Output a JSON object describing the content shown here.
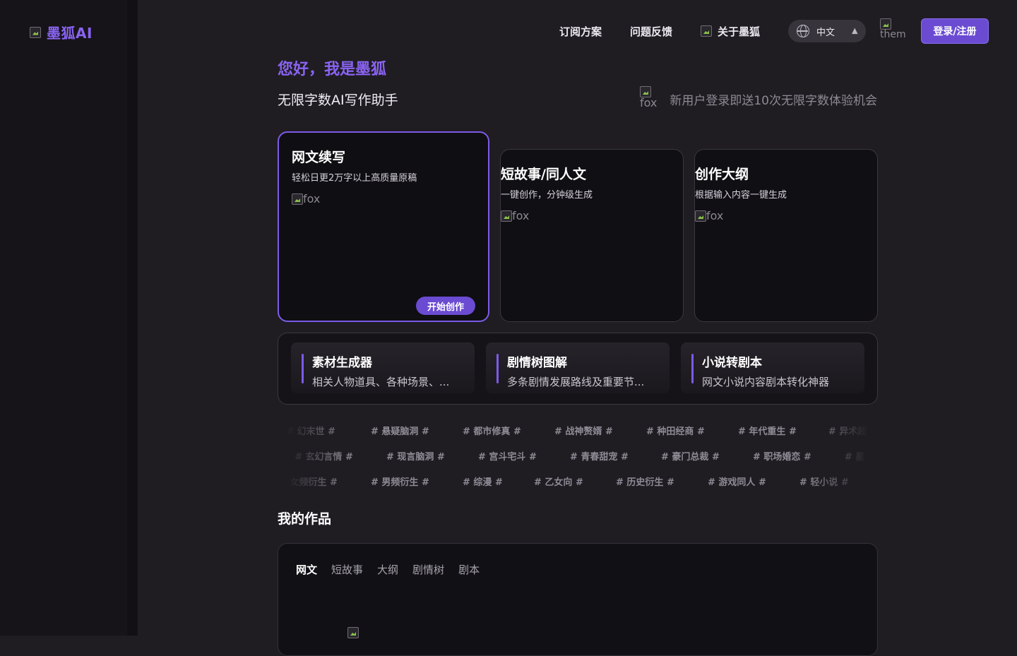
{
  "brand": {
    "name": "墨狐AI",
    "logo_alt": "logo"
  },
  "nav": {
    "subscribe": "订阅方案",
    "feedback": "问题反馈",
    "about": "关于墨狐",
    "language": "中文",
    "theme_alt": "theme",
    "login": "登录/注册"
  },
  "hero": {
    "greeting": "您好，我是墨狐",
    "subtitle": "无限字数AI写作助手",
    "promo_img_alt": "fox",
    "promo": "新用户登录即送10次无限字数体验机会"
  },
  "cards": [
    {
      "title": "网文续写",
      "desc": "轻松日更2万字以上高质量原稿",
      "img_alt": "fox",
      "button": "开始创作"
    },
    {
      "title": "短故事/同人文",
      "desc": "一键创作，分钟级生成",
      "img_alt": "fox"
    },
    {
      "title": "创作大纲",
      "desc": "根据输入内容一键生成",
      "img_alt": "fox"
    }
  ],
  "tools": [
    {
      "title": "素材生成器",
      "desc": "相关人物道具、各种场景、..."
    },
    {
      "title": "剧情树图解",
      "desc": "多条剧情发展路线及重要节..."
    },
    {
      "title": "小说转剧本",
      "desc": "网文小说内容剧本转化神器"
    }
  ],
  "tags": {
    "row1": [
      "# 幻末世 #",
      "# 悬疑脑洞 #",
      "# 都市修真 #",
      "# 战神赘婿 #",
      "# 种田经商 #",
      "# 年代重生 #",
      "# 异术超"
    ],
    "row2": [
      "# 玄幻言情 #",
      "# 现言脑洞 #",
      "# 宫斗宅斗 #",
      "# 青春甜宠 #",
      "# 豪门总裁 #",
      "# 职场婚恋 #",
      "# 星"
    ],
    "row3": [
      "# 女频衍生 #",
      "# 男频衍生 #",
      "# 综漫 #",
      "# 乙女向 #",
      "# 历史衍生 #",
      "# 游戏同人 #",
      "# 轻小说 #"
    ]
  },
  "works": {
    "title": "我的作品",
    "tabs": [
      "网文",
      "短故事",
      "大纲",
      "剧情树",
      "剧本"
    ],
    "active_tab": "网文"
  }
}
